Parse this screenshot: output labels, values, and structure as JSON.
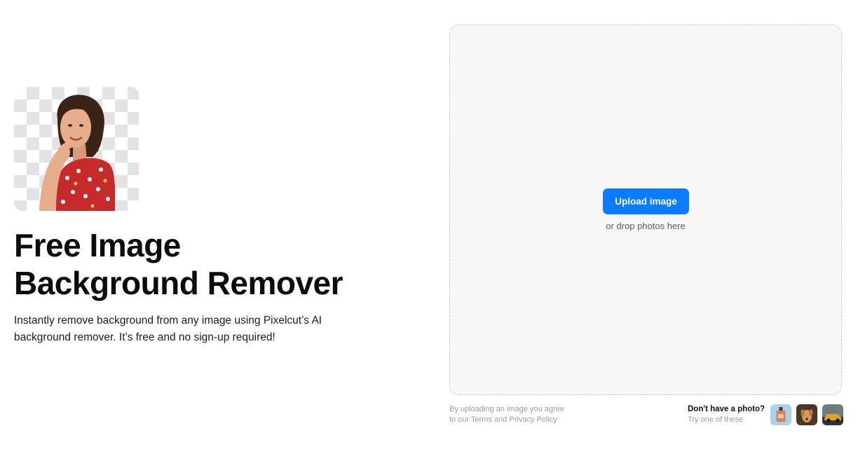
{
  "hero": {
    "title_line1": "Free Image",
    "title_line2": "Background Remover",
    "description": "Instantly remove background from any image using Pixelcut’s AI background remover. It’s free and no sign-up required!"
  },
  "upload": {
    "button_label": "Upload image",
    "drop_hint": "or drop photos here"
  },
  "terms": {
    "line1": "By uploading an image you agree",
    "line2_prefix": "to our ",
    "terms_link": "Terms",
    "and_text": " and ",
    "privacy_link": "Privacy Policy"
  },
  "samples": {
    "heading": "Don't have a photo?",
    "subtext": "Try one of these",
    "items": [
      {
        "icon": "perfume-bottle-sample"
      },
      {
        "icon": "dog-sample"
      },
      {
        "icon": "car-sample"
      }
    ]
  },
  "colors": {
    "accent": "#0a7cff",
    "dropzone_bg": "#f7f7f7",
    "dropzone_border": "#c9c9c9",
    "muted_text": "#9b9b9b"
  }
}
